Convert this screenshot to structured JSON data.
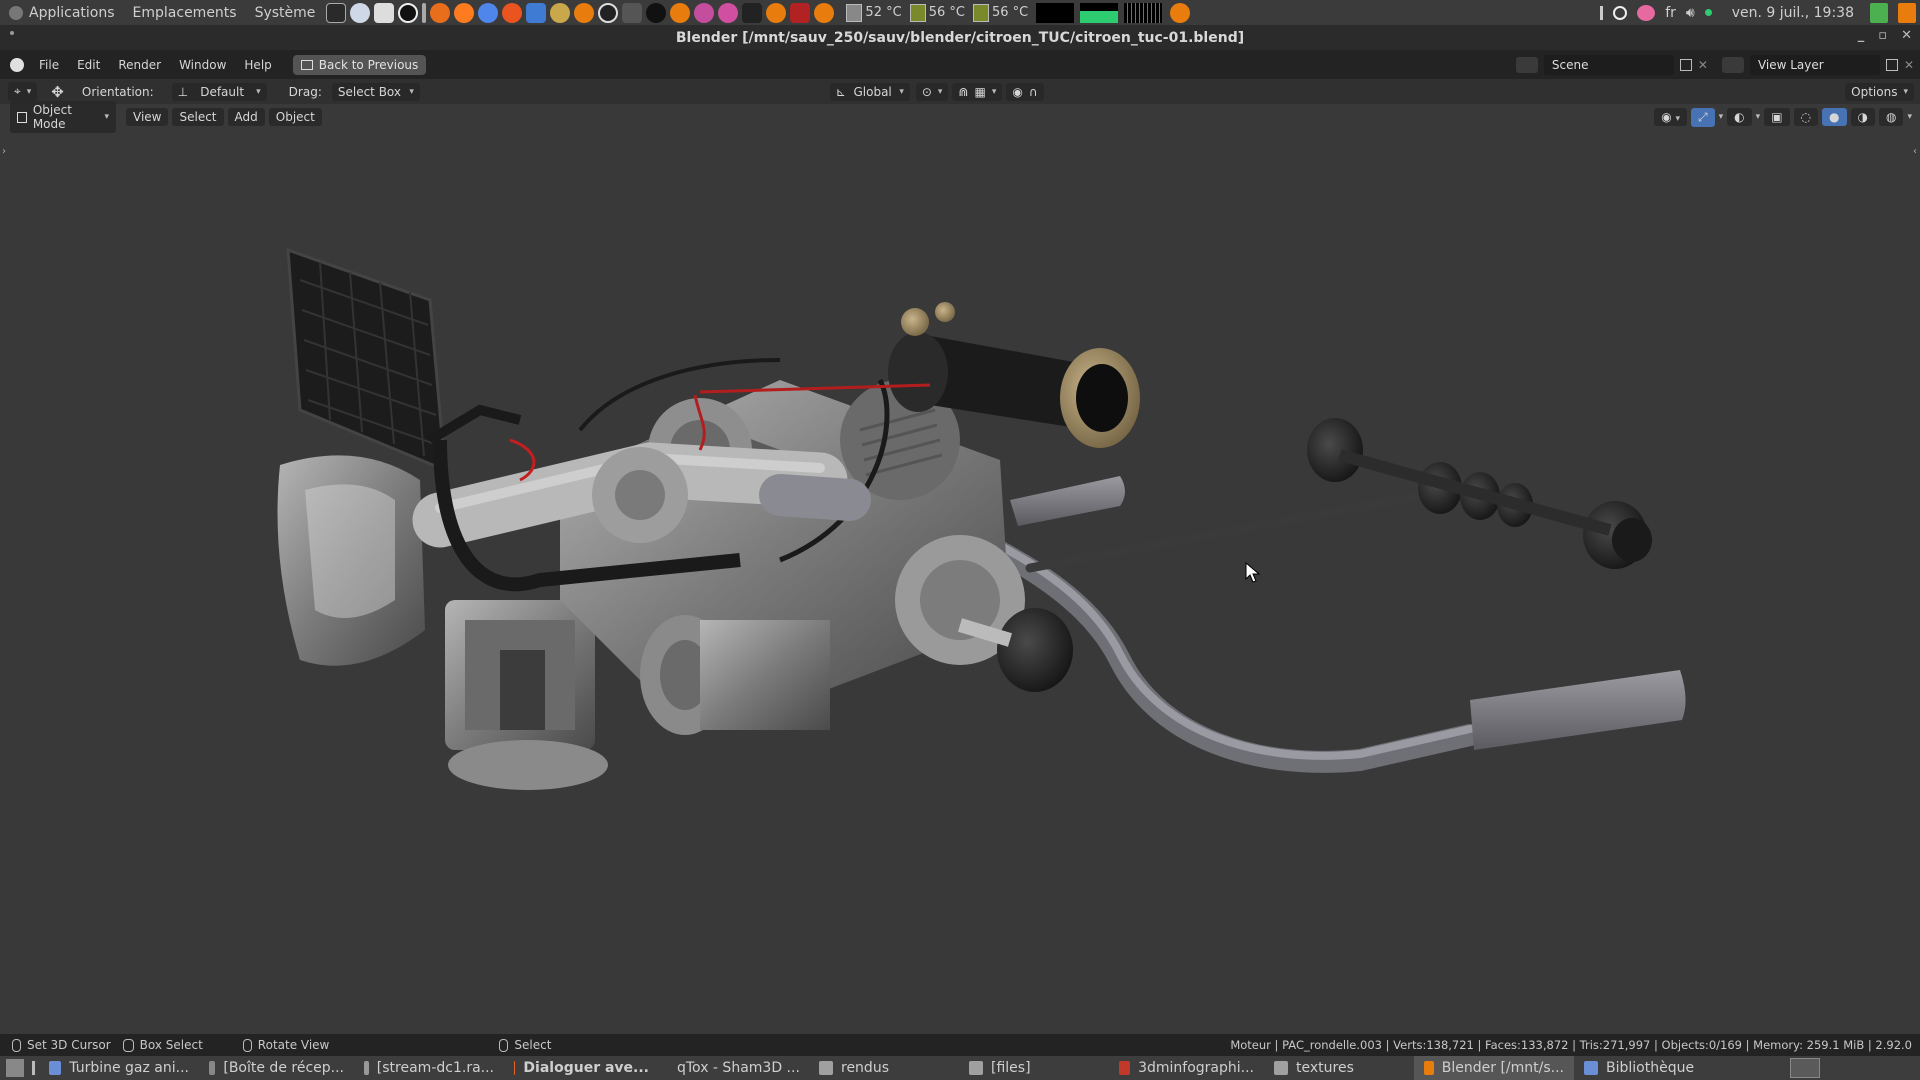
{
  "system_bar": {
    "menus": [
      "Applications",
      "Emplacements",
      "Système"
    ],
    "temps": [
      "52 °C",
      "56 °C",
      "56 °C"
    ],
    "language": "fr",
    "datetime": "ven. 9 juil., 19:38"
  },
  "window": {
    "title": "Blender [/mnt/sauv_250/sauv/blender/citroen_TUC/citroen_tuc-01.blend]"
  },
  "blender_topbar": {
    "menus": [
      "File",
      "Edit",
      "Render",
      "Window",
      "Help"
    ],
    "back_button": "Back to Previous",
    "scene": "Scene",
    "view_layer": "View Layer"
  },
  "tool_header": {
    "orientation_label": "Orientation:",
    "orientation_value": "Default",
    "drag_label": "Drag:",
    "drag_value": "Select Box",
    "transform_orientation": "Global",
    "options": "Options"
  },
  "viewport_header": {
    "mode": "Object Mode",
    "menus": [
      "View",
      "Select",
      "Add",
      "Object"
    ]
  },
  "status_bar": {
    "hints": [
      "Set 3D Cursor",
      "Box Select",
      "Rotate View",
      "Select"
    ],
    "stats": "Moteur | PAC_rondelle.003 | Verts:138,721 | Faces:133,872 | Tris:271,997 | Objects:0/169 | Memory: 259.1 MiB | 2.92.0"
  },
  "taskbar": {
    "tasks": [
      {
        "label": "Turbine gaz ani...",
        "color": "#6a8fd6"
      },
      {
        "label": "[Boîte de récep...",
        "color": "#888"
      },
      {
        "label": "[stream-dc1.ra...",
        "color": "#999"
      },
      {
        "label": "Dialoguer ave...",
        "color": "#e2642a"
      },
      {
        "label": "qTox - Sham3D ...",
        "color": "#4caf50"
      },
      {
        "label": "rendus",
        "color": "#a0a0a0"
      },
      {
        "label": "[files]",
        "color": "#a0a0a0"
      },
      {
        "label": "3dminfographi...",
        "color": "#c0392b"
      },
      {
        "label": "textures",
        "color": "#a0a0a0"
      },
      {
        "label": "Blender [/mnt/s...",
        "color": "#e87d0d"
      },
      {
        "label": "Bibliothèque",
        "color": "#6a8fd6"
      }
    ]
  },
  "colors": {
    "viewport_bg": "#393939",
    "blender_orange": "#e87d0d",
    "accent_blue": "#4772b3"
  }
}
